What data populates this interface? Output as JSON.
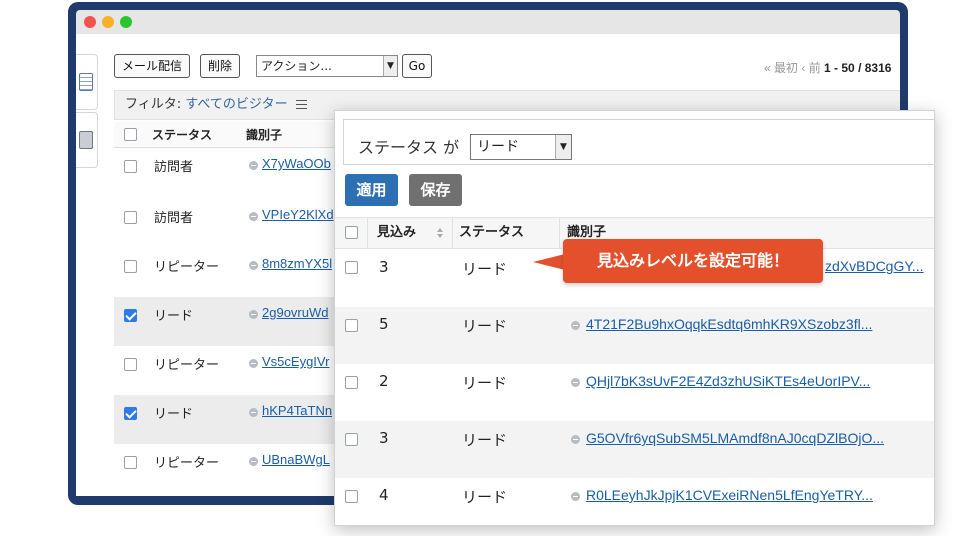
{
  "toolbar": {
    "mail_label": "メール配信",
    "delete_label": "削除",
    "action_label": "アクション...",
    "go_label": "Go",
    "pager_first": "« 最初",
    "pager_prev": "‹ 前",
    "pager_range": "1 - 50 / 8316"
  },
  "filter": {
    "label": "フィルタ:",
    "value": "すべてのビジター"
  },
  "back_table": {
    "headers": [
      "ステータス",
      "識別子"
    ],
    "rows": [
      {
        "status": "訪問者",
        "id": "X7yWaOOb",
        "checked": false
      },
      {
        "status": "訪問者",
        "id": "VPIeY2KlXd",
        "checked": false
      },
      {
        "status": "リピーター",
        "id": "8m8zmYX5l",
        "checked": false
      },
      {
        "status": "リード",
        "id": "2g9ovruWd",
        "checked": true
      },
      {
        "status": "リピーター",
        "id": "Vs5cEygIVr",
        "checked": false
      },
      {
        "status": "リード",
        "id": "hKP4TaTNn",
        "checked": true
      },
      {
        "status": "リピーター",
        "id": "UBnaBWgL",
        "checked": false
      }
    ]
  },
  "panel": {
    "filter_label": "ステータス が",
    "filter_value": "リード",
    "apply_label": "適用",
    "save_label": "保存",
    "headers": [
      "見込み",
      "ステータス",
      "識別子"
    ],
    "rows": [
      {
        "score": "3",
        "status": "リード",
        "id": "zdXvBDCgGY..."
      },
      {
        "score": "5",
        "status": "リード",
        "id": "4T21F2Bu9hxOqqkEsdtq6mhKR9XSzobz3fl..."
      },
      {
        "score": "2",
        "status": "リード",
        "id": "QHjl7bK3sUvF2E4Zd3zhUSiKTEs4eUorIPV..."
      },
      {
        "score": "3",
        "status": "リード",
        "id": "G5OVfr6yqSubSM5LMAmdf8nAJ0cqDZlBOjO..."
      },
      {
        "score": "4",
        "status": "リード",
        "id": "R0LEeyhJkJpjK1CVExeiRNen5LfEngYeTRY..."
      }
    ]
  },
  "callout": {
    "text": "見込みレベルを設定可能！"
  },
  "colors": {
    "window_frame": "#1f3b6b",
    "apply_button": "#2d6fb3",
    "save_button": "#707070",
    "callout": "#e4502c",
    "link": "#1a5ea8"
  }
}
